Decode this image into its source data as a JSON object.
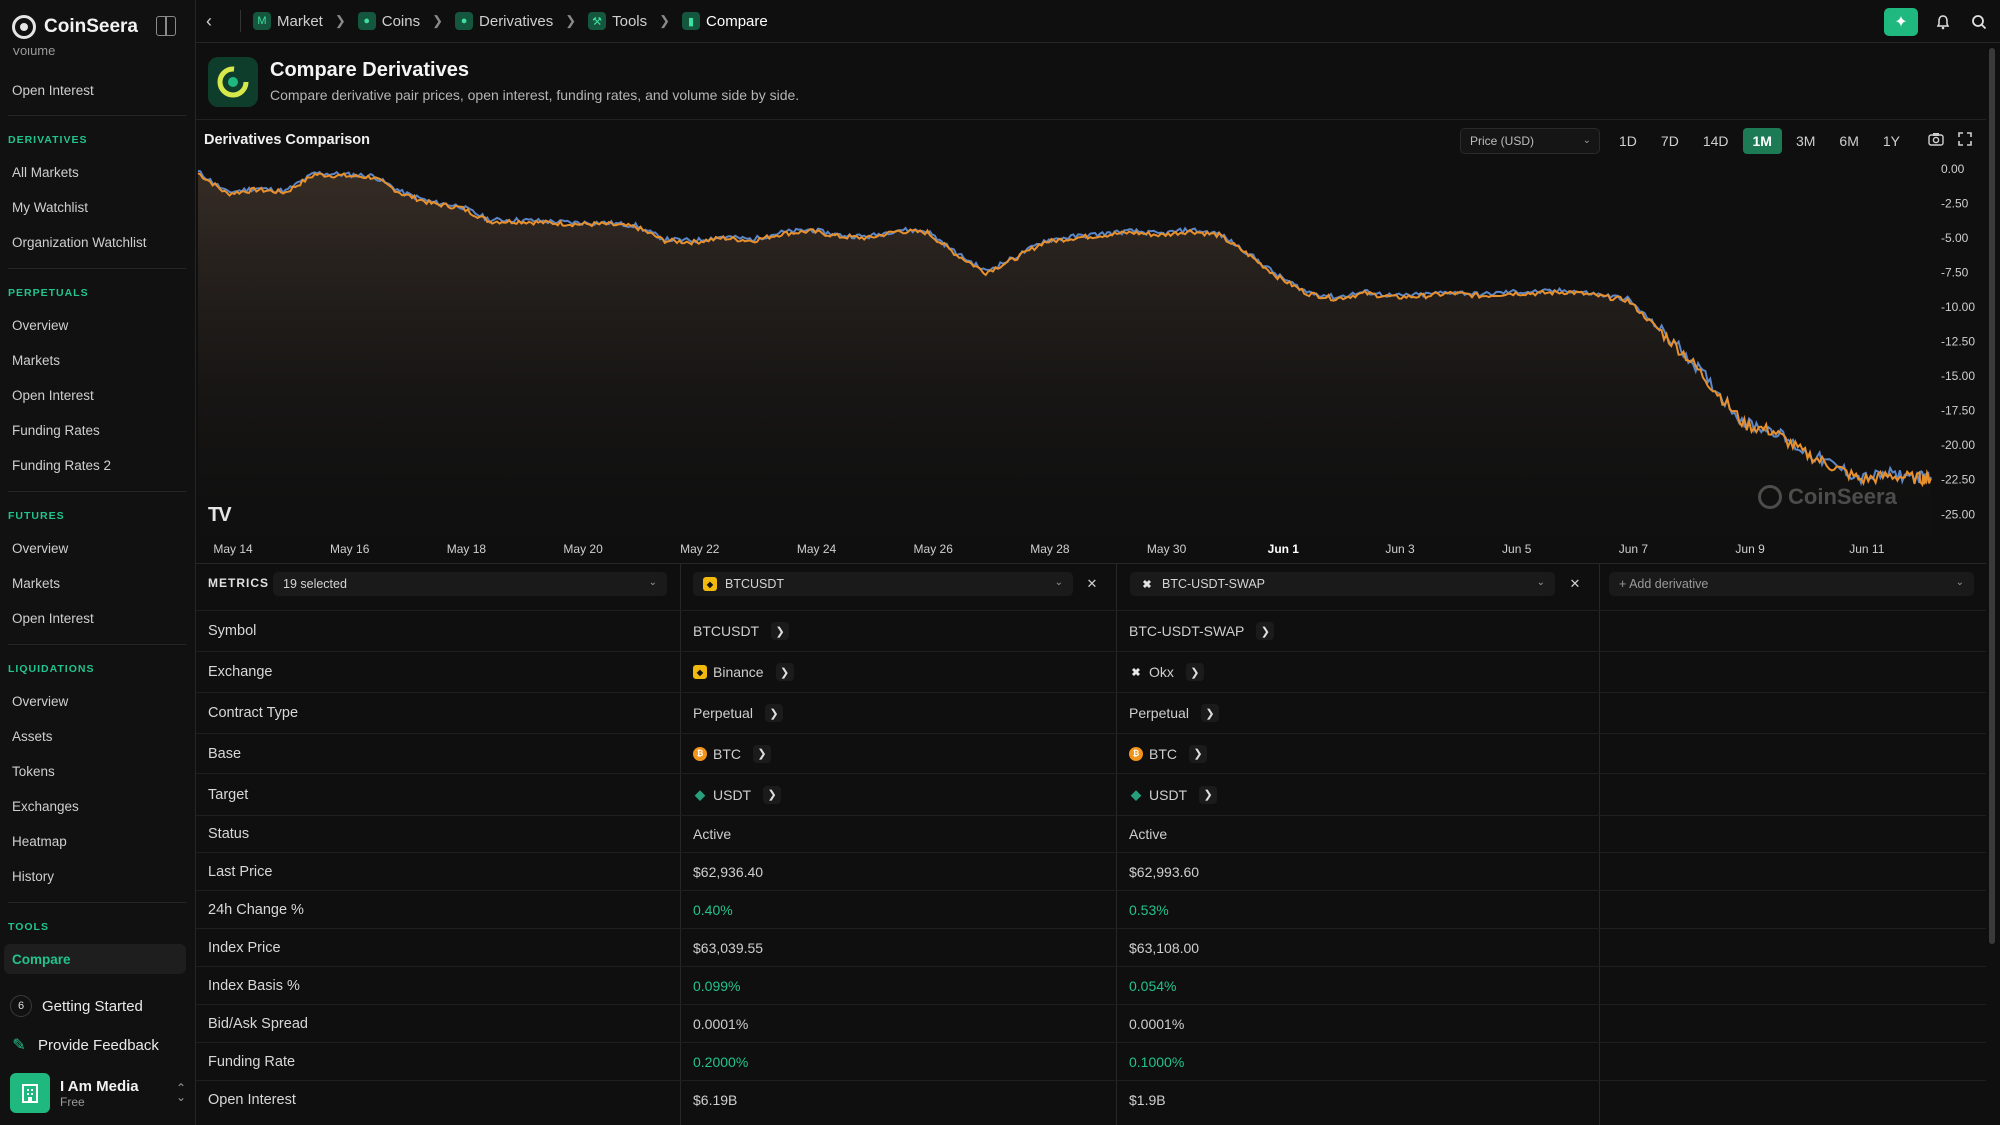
{
  "app": {
    "name": "CoinSeera"
  },
  "sidebar": {
    "cut_item": "Volume",
    "open_interest_top": "Open Interest",
    "sections": [
      {
        "title": "DERIVATIVES",
        "items": [
          "All Markets",
          "My Watchlist",
          "Organization Watchlist"
        ]
      },
      {
        "title": "PERPETUALS",
        "items": [
          "Overview",
          "Markets",
          "Open Interest",
          "Funding Rates",
          "Funding Rates 2"
        ]
      },
      {
        "title": "FUTURES",
        "items": [
          "Overview",
          "Markets",
          "Open Interest"
        ]
      },
      {
        "title": "LIQUIDATIONS",
        "items": [
          "Overview",
          "Assets",
          "Tokens",
          "Exchanges",
          "Heatmap",
          "History"
        ]
      },
      {
        "title": "TOOLS",
        "items": [
          "Compare"
        ]
      }
    ],
    "getting_started_count": "6",
    "getting_started": "Getting Started",
    "feedback": "Provide Feedback",
    "user_name": "I Am Media",
    "user_plan": "Free"
  },
  "breadcrumbs": [
    "Market",
    "Coins",
    "Derivatives",
    "Tools",
    "Compare"
  ],
  "page": {
    "title": "Compare Derivatives",
    "subtitle": "Compare derivative pair prices, open interest, funding rates, and volume side by side."
  },
  "chart_panel": {
    "title": "Derivatives Comparison",
    "metric": "Price (USD)",
    "ranges": [
      "1D",
      "7D",
      "14D",
      "1M",
      "3M",
      "6M",
      "1Y"
    ],
    "active_range": "1M",
    "watermark": "CoinSeera",
    "tv_logo": "TV"
  },
  "chart_data": {
    "type": "line",
    "x_ticks": [
      "May 14",
      "May 16",
      "May 18",
      "May 20",
      "May 22",
      "May 24",
      "May 26",
      "May 28",
      "May 30",
      "Jun 1",
      "Jun 3",
      "Jun 5",
      "Jun 7",
      "Jun 9",
      "Jun 11"
    ],
    "y_ticks": [
      "0.00",
      "-2.50",
      "-5.00",
      "-7.50",
      "-10.00",
      "-12.50",
      "-15.00",
      "-17.50",
      "-20.00",
      "-22.50",
      "-25.00"
    ],
    "ylim": [
      -26.5,
      0.5
    ],
    "x_range_days": [
      0,
      29.7
    ],
    "grid": false,
    "series": [
      {
        "name": "BTCUSDT",
        "color": "#e8902c",
        "points": [
          [
            0,
            -0.3
          ],
          [
            0.5,
            -1.8
          ],
          [
            1,
            -1.5
          ],
          [
            1.5,
            -1.7
          ],
          [
            2,
            -0.4
          ],
          [
            2.5,
            -0.5
          ],
          [
            3,
            -0.6
          ],
          [
            3.5,
            -1.8
          ],
          [
            4,
            -2.5
          ],
          [
            4.5,
            -2.8
          ],
          [
            5,
            -3.8
          ],
          [
            5.5,
            -3.8
          ],
          [
            6,
            -3.9
          ],
          [
            6.5,
            -4.0
          ],
          [
            7,
            -4.0
          ],
          [
            7.5,
            -4.2
          ],
          [
            8,
            -5.2
          ],
          [
            8.5,
            -5.3
          ],
          [
            9,
            -5.0
          ],
          [
            9.5,
            -5.2
          ],
          [
            10,
            -4.7
          ],
          [
            10.5,
            -4.5
          ],
          [
            11,
            -4.9
          ],
          [
            11.5,
            -5.0
          ],
          [
            12,
            -4.5
          ],
          [
            12.5,
            -4.6
          ],
          [
            13,
            -6.2
          ],
          [
            13.5,
            -7.5
          ],
          [
            14,
            -6.5
          ],
          [
            14.5,
            -5.3
          ],
          [
            15,
            -5.0
          ],
          [
            15.5,
            -4.8
          ],
          [
            16,
            -4.6
          ],
          [
            16.5,
            -4.8
          ],
          [
            17,
            -4.5
          ],
          [
            17.5,
            -4.8
          ],
          [
            18,
            -6.2
          ],
          [
            18.5,
            -7.8
          ],
          [
            19,
            -9.0
          ],
          [
            19.5,
            -9.4
          ],
          [
            20,
            -9.0
          ],
          [
            20.5,
            -9.3
          ],
          [
            21,
            -9.2
          ],
          [
            21.5,
            -9.0
          ],
          [
            22,
            -9.2
          ],
          [
            22.5,
            -9.0
          ],
          [
            23,
            -9.0
          ],
          [
            23.5,
            -8.9
          ],
          [
            24,
            -9.2
          ],
          [
            24.5,
            -9.5
          ],
          [
            25,
            -11.5
          ],
          [
            25.5,
            -13.5
          ],
          [
            26,
            -16.0
          ],
          [
            26.5,
            -18.5
          ],
          [
            27,
            -19.0
          ],
          [
            27.5,
            -20.5
          ],
          [
            28,
            -21.5
          ],
          [
            28.5,
            -22.5
          ],
          [
            29,
            -22.2
          ],
          [
            29.5,
            -22.4
          ],
          [
            29.7,
            -22.4
          ]
        ]
      },
      {
        "name": "BTC-USDT-SWAP",
        "color": "#5b86c8",
        "points": [
          [
            0,
            -0.2
          ],
          [
            0.5,
            -1.7
          ],
          [
            1,
            -1.4
          ],
          [
            1.5,
            -1.6
          ],
          [
            2,
            -0.3
          ],
          [
            2.5,
            -0.4
          ],
          [
            3,
            -0.5
          ],
          [
            3.5,
            -1.7
          ],
          [
            4,
            -2.4
          ],
          [
            4.5,
            -2.7
          ],
          [
            5,
            -3.7
          ],
          [
            5.5,
            -3.7
          ],
          [
            6,
            -3.8
          ],
          [
            6.5,
            -3.9
          ],
          [
            7,
            -3.9
          ],
          [
            7.5,
            -4.1
          ],
          [
            8,
            -5.1
          ],
          [
            8.5,
            -5.2
          ],
          [
            9,
            -4.9
          ],
          [
            9.5,
            -5.1
          ],
          [
            10,
            -4.6
          ],
          [
            10.5,
            -4.4
          ],
          [
            11,
            -4.8
          ],
          [
            11.5,
            -4.9
          ],
          [
            12,
            -4.4
          ],
          [
            12.5,
            -4.5
          ],
          [
            13,
            -6.1
          ],
          [
            13.5,
            -7.4
          ],
          [
            14,
            -6.4
          ],
          [
            14.5,
            -5.2
          ],
          [
            15,
            -4.9
          ],
          [
            15.5,
            -4.7
          ],
          [
            16,
            -4.5
          ],
          [
            16.5,
            -4.7
          ],
          [
            17,
            -4.4
          ],
          [
            17.5,
            -4.7
          ],
          [
            18,
            -6.1
          ],
          [
            18.5,
            -7.7
          ],
          [
            19,
            -8.9
          ],
          [
            19.5,
            -9.3
          ],
          [
            20,
            -8.9
          ],
          [
            20.5,
            -9.2
          ],
          [
            21,
            -9.1
          ],
          [
            21.5,
            -8.9
          ],
          [
            22,
            -9.1
          ],
          [
            22.5,
            -8.9
          ],
          [
            23,
            -8.9
          ],
          [
            23.5,
            -8.8
          ],
          [
            24,
            -9.1
          ],
          [
            24.5,
            -9.4
          ],
          [
            25,
            -11.4
          ],
          [
            25.5,
            -13.4
          ],
          [
            26,
            -15.9
          ],
          [
            26.5,
            -18.4
          ],
          [
            27,
            -18.9
          ],
          [
            27.5,
            -20.4
          ],
          [
            28,
            -21.4
          ],
          [
            28.5,
            -22.4
          ],
          [
            29,
            -22.1
          ],
          [
            29.5,
            -22.3
          ],
          [
            29.7,
            -22.3
          ]
        ]
      }
    ]
  },
  "compare": {
    "metrics_label": "METRICS",
    "metrics_selected": "19 selected",
    "columns": [
      {
        "name": "BTCUSDT"
      },
      {
        "name": "BTC-USDT-SWAP"
      }
    ],
    "add_label": "+ Add derivative",
    "rows": [
      {
        "label": "Symbol",
        "values": [
          "BTCUSDT",
          "BTC-USDT-SWAP"
        ]
      },
      {
        "label": "Exchange",
        "values": [
          "Binance",
          "Okx"
        ]
      },
      {
        "label": "Contract Type",
        "values": [
          "Perpetual",
          "Perpetual"
        ]
      },
      {
        "label": "Base",
        "values": [
          "BTC",
          "BTC"
        ]
      },
      {
        "label": "Target",
        "values": [
          "USDT",
          "USDT"
        ]
      },
      {
        "label": "Status",
        "values": [
          "Active",
          "Active"
        ]
      },
      {
        "label": "Last Price",
        "values": [
          "$62,936.40",
          "$62,993.60"
        ]
      },
      {
        "label": "24h Change %",
        "values": [
          "0.40%",
          "0.53%"
        ]
      },
      {
        "label": "Index Price",
        "values": [
          "$63,039.55",
          "$63,108.00"
        ]
      },
      {
        "label": "Index Basis %",
        "values": [
          "0.099%",
          "0.054%"
        ]
      },
      {
        "label": "Bid/Ask Spread",
        "values": [
          "0.0001%",
          "0.0001%"
        ]
      },
      {
        "label": "Funding Rate",
        "values": [
          "0.2000%",
          "0.1000%"
        ]
      },
      {
        "label": "Open Interest",
        "values": [
          "$6.19B",
          "$1.9B"
        ]
      }
    ]
  }
}
